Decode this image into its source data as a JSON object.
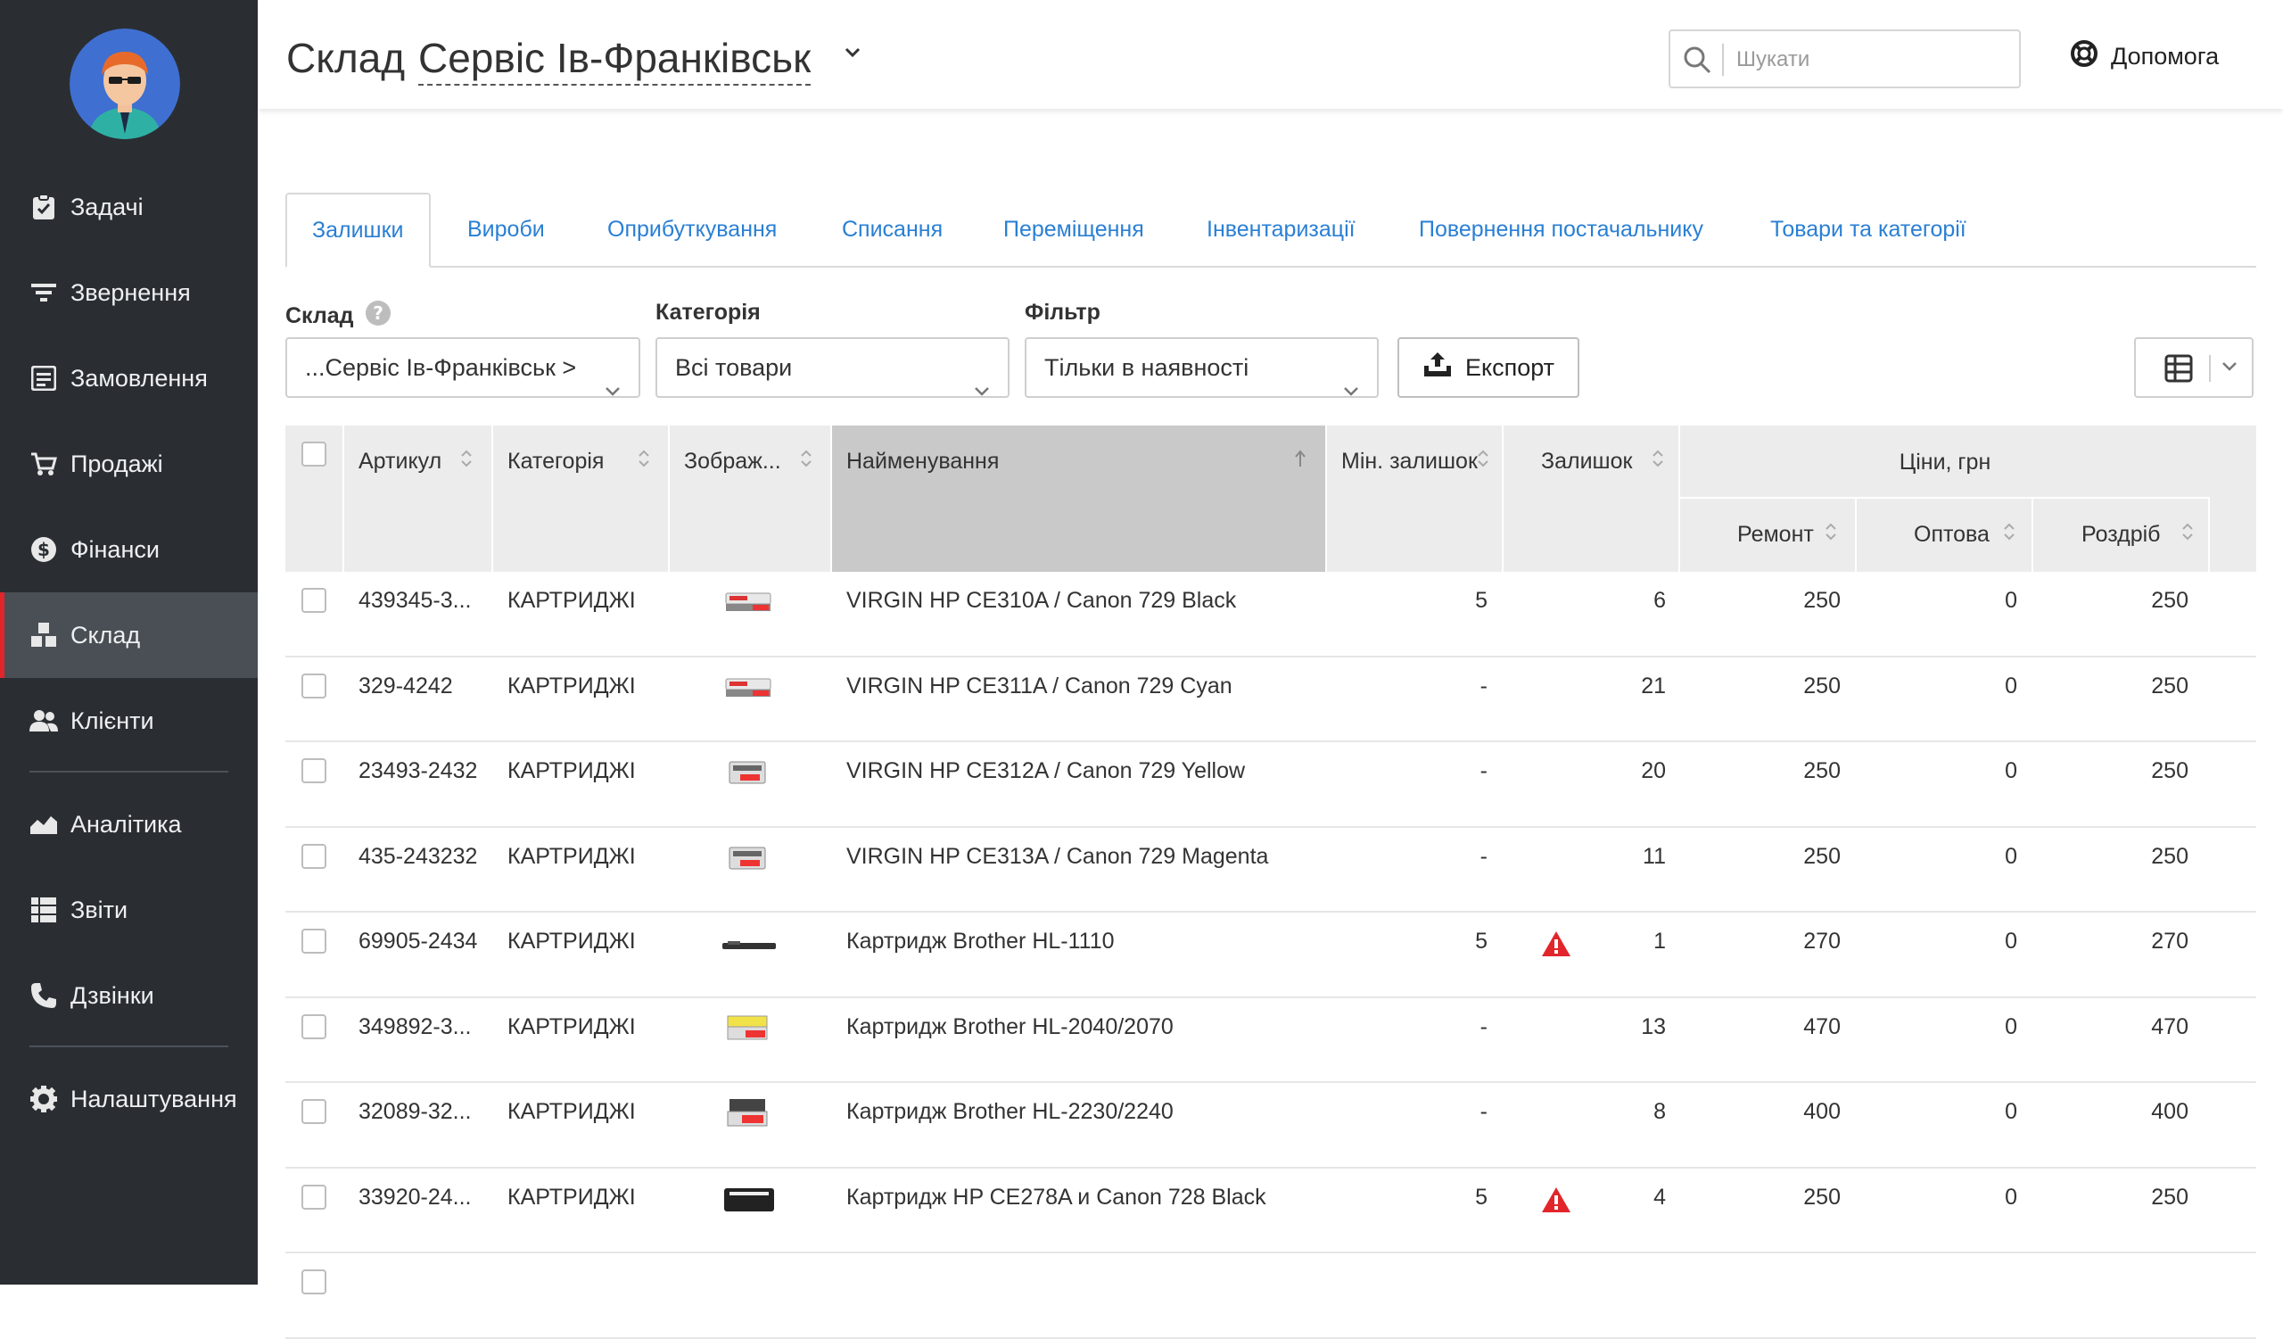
{
  "sidebar": {
    "items": [
      {
        "label": "Задачі",
        "icon": "clipboard-check-icon"
      },
      {
        "label": "Звернення",
        "icon": "filter-lines-icon"
      },
      {
        "label": "Замовлення",
        "icon": "order-list-icon"
      },
      {
        "label": "Продажі",
        "icon": "cart-icon"
      },
      {
        "label": "Фінанси",
        "icon": "dollar-circle-icon"
      },
      {
        "label": "Склад",
        "icon": "boxes-icon",
        "active": true
      },
      {
        "label": "Клієнти",
        "icon": "users-icon"
      },
      {
        "label": "Аналітика",
        "icon": "area-chart-icon"
      },
      {
        "label": "Звіти",
        "icon": "report-list-icon"
      },
      {
        "label": "Дзвінки",
        "icon": "phone-icon"
      },
      {
        "label": "Налаштування",
        "icon": "gear-icon"
      }
    ]
  },
  "header": {
    "title_prefix": "Склад",
    "store": "Сервіс Ів-Франківськ",
    "search_placeholder": "Шукати",
    "help": "Допомога"
  },
  "tabs": [
    "Залишки",
    "Вироби",
    "Оприбуткування",
    "Списання",
    "Переміщення",
    "Інвентаризації",
    "Повернення постачальнику",
    "Товари та категорії"
  ],
  "filters": {
    "warehouse_label": "Склад",
    "warehouse_value": "...Сервіс Ів-Франківськ >",
    "category_label": "Категорія",
    "category_value": "Всі товари",
    "filter_label": "Фільтр",
    "filter_value": "Тільки в наявності",
    "export": "Експорт"
  },
  "table": {
    "columns": {
      "sku": "Артикул",
      "category": "Категорія",
      "image": "Зображ...",
      "name": "Найменування",
      "min_stock": "Мін. залишок",
      "stock": "Залишок",
      "prices": "Ціни, грн",
      "repair": "Ремонт",
      "wholesale": "Оптова",
      "retail": "Роздріб"
    },
    "rows": [
      {
        "sku": "439345-3...",
        "category": "КАРТРИДЖІ",
        "name": "VIRGIN HP CE310A / Canon 729 Black",
        "min": "5",
        "stock": "6",
        "repair": "250",
        "wholesale": "0",
        "retail": "250",
        "warn": false
      },
      {
        "sku": "329-4242",
        "category": "КАРТРИДЖІ",
        "name": "VIRGIN HP CE311A / Canon 729 Cyan",
        "min": "-",
        "stock": "21",
        "repair": "250",
        "wholesale": "0",
        "retail": "250",
        "warn": false
      },
      {
        "sku": "23493-2432",
        "category": "КАРТРИДЖІ",
        "name": "VIRGIN HP CE312A / Canon 729 Yellow",
        "min": "-",
        "stock": "20",
        "repair": "250",
        "wholesale": "0",
        "retail": "250",
        "warn": false
      },
      {
        "sku": "435-243232",
        "category": "КАРТРИДЖІ",
        "name": "VIRGIN HP CE313A / Canon 729 Magenta",
        "min": "-",
        "stock": "11",
        "repair": "250",
        "wholesale": "0",
        "retail": "250",
        "warn": false
      },
      {
        "sku": "69905-2434",
        "category": "КАРТРИДЖІ",
        "name": "Картридж Brother HL-1110",
        "min": "5",
        "stock": "1",
        "repair": "270",
        "wholesale": "0",
        "retail": "270",
        "warn": true
      },
      {
        "sku": "349892-3...",
        "category": "КАРТРИДЖІ",
        "name": "Картридж Brother HL-2040/2070",
        "min": "-",
        "stock": "13",
        "repair": "470",
        "wholesale": "0",
        "retail": "470",
        "warn": false
      },
      {
        "sku": "32089-32...",
        "category": "КАРТРИДЖІ",
        "name": "Картридж Brother HL-2230/2240",
        "min": "-",
        "stock": "8",
        "repair": "400",
        "wholesale": "0",
        "retail": "400",
        "warn": false
      },
      {
        "sku": "33920-24...",
        "category": "КАРТРИДЖІ",
        "name": "Картридж HP CE278A и Canon 728 Black",
        "min": "5",
        "stock": "4",
        "repair": "250",
        "wholesale": "0",
        "retail": "250",
        "warn": true
      }
    ]
  },
  "colors": {
    "sidebar": "#2a2e33",
    "active": "#4a4f55",
    "accent_red": "#e0262b",
    "link": "#2a7fd4"
  }
}
